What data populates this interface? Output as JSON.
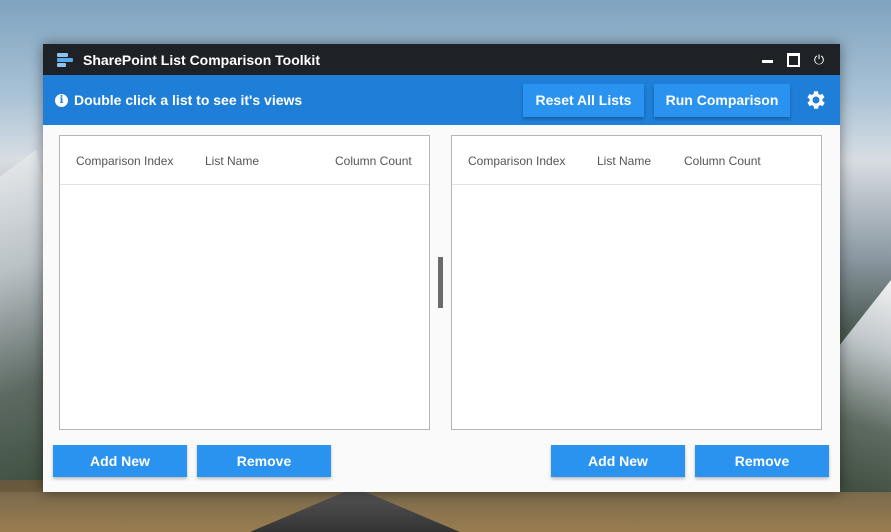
{
  "window": {
    "title": "SharePoint List Comparison Toolkit",
    "power_glyph": "⏻",
    "icons": [
      "app-list-icon",
      "minimize-icon",
      "maximize-icon",
      "power-icon"
    ]
  },
  "toolbar": {
    "info_glyph": "i",
    "hint": "Double click a list to see it's views",
    "reset_label": "Reset All Lists",
    "run_label": "Run Comparison",
    "settings_icon": "gear-icon"
  },
  "left_panel": {
    "columns": [
      "Comparison Index",
      "List Name",
      "Column Count"
    ],
    "rows": [],
    "add_label": "Add New",
    "remove_label": "Remove"
  },
  "right_panel": {
    "columns": [
      "Comparison Index",
      "List Name",
      "Column Count"
    ],
    "rows": [],
    "add_label": "Add New",
    "remove_label": "Remove"
  },
  "colors": {
    "titlebar": "#1e2227",
    "toolbar": "#1e7ed8",
    "button": "#2a93ef"
  }
}
